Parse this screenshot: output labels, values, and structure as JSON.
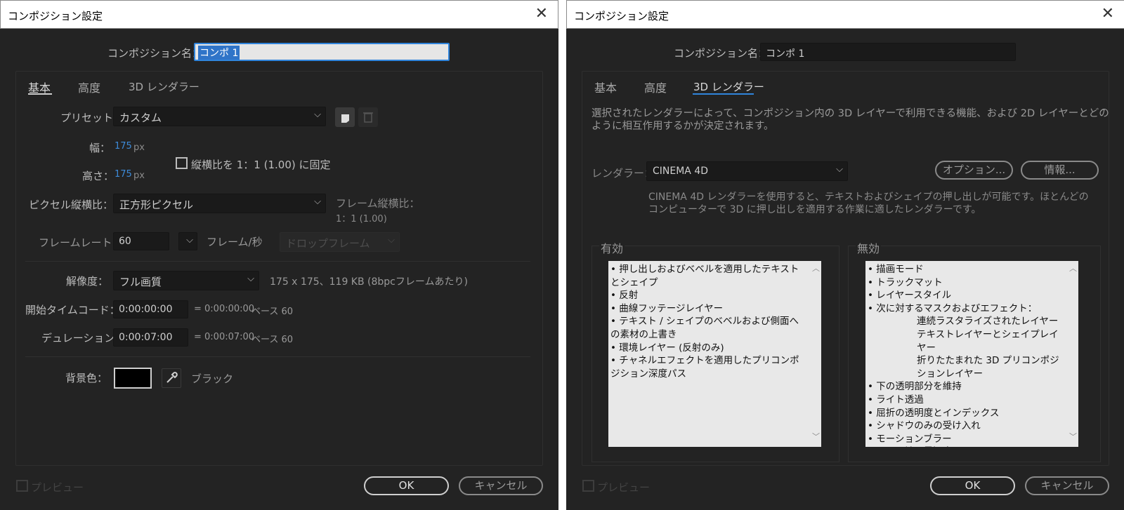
{
  "left": {
    "title": "コンポジション設定",
    "close": "✕",
    "comp_name_label": "コンポジション名：",
    "comp_name_value": "コンポ 1",
    "tabs": [
      "基本",
      "高度",
      "3D レンダラー"
    ],
    "preset_label": "プリセット：",
    "preset_value": "カスタム",
    "width_label": "幅：",
    "width_value": "175",
    "height_label": "高さ：",
    "height_value": "175",
    "unit_px": "px",
    "lock_aspect_label": "縦横比を 1：1 (1.00) に固定",
    "pixel_aspect_label": "ピクセル縦横比：",
    "pixel_aspect_value": "正方形ピクセル",
    "frame_aspect_label": "フレーム縦横比：",
    "frame_aspect_value": "1：1 (1.00)",
    "framerate_label": "フレームレート：",
    "framerate_value": "60",
    "framerate_unit": "フレーム/秒",
    "dropframe_value": "ドロップフレーム",
    "resolution_label": "解像度：",
    "resolution_value": "フル画質",
    "resolution_info": "175 x 175、119 KB (8bpcフレームあたり)",
    "start_tc_label": "開始タイムコード：",
    "start_tc_value": "0:00:00:00",
    "start_tc_info": "= 0:00:00:00",
    "start_tc_base": "ベース 60",
    "duration_label": "デュレーション：",
    "duration_value": "0:00:07:00",
    "duration_info": "= 0:00:07:00",
    "duration_base": "ベース 60",
    "bg_label": "背景色：",
    "bg_color": "#000000",
    "bg_color_name": "ブラック",
    "preview_label": "プレビュー",
    "ok_label": "OK",
    "cancel_label": "キャンセル"
  },
  "right": {
    "title": "コンポジション設定",
    "close": "✕",
    "comp_name_label": "コンポジション名：",
    "comp_name_value": "コンポ 1",
    "tabs": [
      "基本",
      "高度",
      "3D レンダラー"
    ],
    "description": "選択されたレンダラーによって、コンポジション内の 3D レイヤーで利用できる機能、および 2D レイヤーとどのように相互作用するかが決定されます。",
    "renderer_label": "レンダラー：",
    "renderer_value": "CINEMA 4D",
    "options_label": "オプション...",
    "info_label": "情報...",
    "renderer_desc": "CINEMA 4D レンダラーを使用すると、テキストおよびシェイプの押し出しが可能です。ほとんどのコンピューターで 3D に押し出しを適用する作業に適したレンダラーです。",
    "enabled_label": "有効",
    "disabled_label": "無効",
    "enabled_items": [
      "• 押し出しおよびベベルを適用したテキストとシェイプ",
      "• 反射",
      "• 曲線フッテージレイヤー",
      "• テキスト / シェイプのベベルおよび側面への素材の上書き",
      "• 環境レイヤー (反射のみ)",
      "• チャネルエフェクトを適用したプリコンポジション深度パス"
    ],
    "disabled_items": [
      "• 描画モード",
      "• トラックマット",
      "• レイヤースタイル",
      "• 次に対するマスクおよびエフェクト：",
      "連続ラスタライズされたレイヤー",
      "テキストレイヤーとシェイプレイヤー",
      "折りたたまれた 3D プリコンポジションレイヤー",
      "• 下の透明部分を維持",
      "• ライト透過",
      "• 屈折の透明度とインデックス",
      "• シャドウのみの受け入れ",
      "• モーションブラー",
      "• カメラ被写界深度"
    ],
    "preview_label": "プレビュー",
    "ok_label": "OK",
    "cancel_label": "キャンセル"
  },
  "colors": {
    "accent_blue": "#2f84db",
    "bg": "#232323",
    "field": "#1a1a1a",
    "name_field_active": "#e6e6e6"
  }
}
